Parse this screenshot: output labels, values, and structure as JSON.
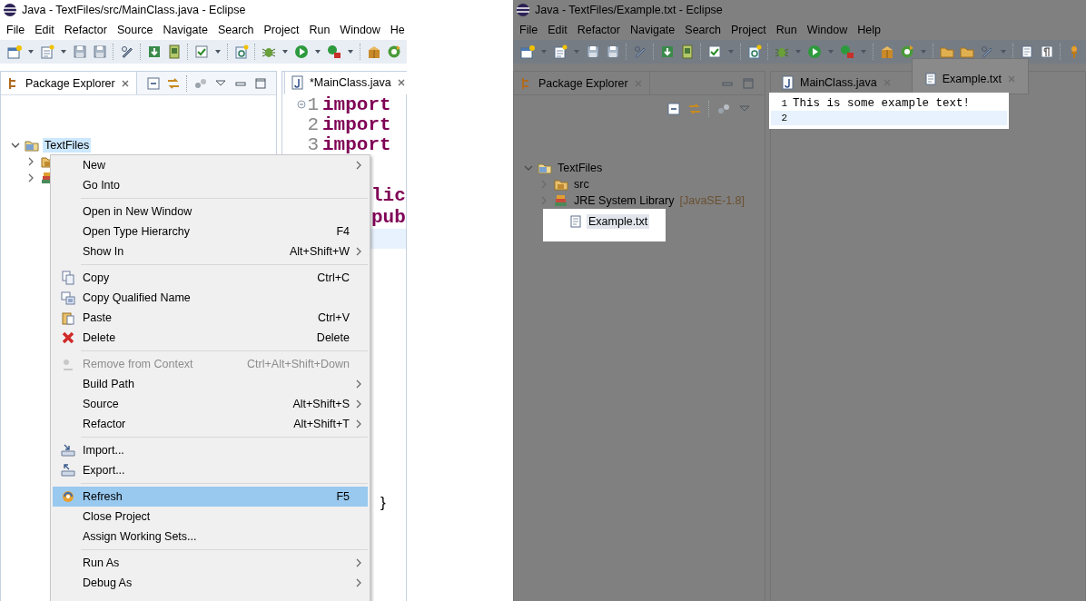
{
  "windows": [
    {
      "title": "Java - TextFiles/src/MainClass.java - Eclipse",
      "dimmed": false,
      "menu": [
        "File",
        "Edit",
        "Refactor",
        "Source",
        "Navigate",
        "Search",
        "Project",
        "Run",
        "Window",
        "He"
      ],
      "explorer": {
        "tab": "Package Explorer",
        "tree": [
          {
            "label": "TextFiles",
            "kind": "project",
            "expanded": true,
            "selected": true,
            "highlighted": false,
            "children": [
              {
                "kind": "package-folder",
                "expanded": false
              },
              {
                "kind": "library",
                "expanded": false
              }
            ]
          }
        ]
      },
      "editor": {
        "highlighted": false,
        "tabs": [
          {
            "label": "*MainClass.java",
            "kind": "java",
            "selected": true,
            "highlighted": false
          }
        ],
        "lines": [
          {
            "number": "1",
            "text": "import",
            "foldable": true
          },
          {
            "number": "2",
            "text": "import"
          },
          {
            "number": "3",
            "text": "import"
          },
          {
            "text": "lic"
          },
          {
            "text": "pub"
          },
          {
            "current": true
          }
        ],
        "closing": "}"
      },
      "context_menu": {
        "items": [
          {
            "kind": "plain",
            "label": "New",
            "submenu": true,
            "disabled": false,
            "selected": false
          },
          {
            "kind": "plain",
            "label": "Go Into",
            "submenu": false,
            "disabled": false,
            "selected": false
          },
          {
            "kind": "separator"
          },
          {
            "kind": "plain",
            "label": "Open in New Window",
            "submenu": false,
            "disabled": false,
            "selected": false
          },
          {
            "kind": "plain",
            "label": "Open Type Hierarchy",
            "shortcut": "F4",
            "submenu": false,
            "disabled": false,
            "selected": false
          },
          {
            "kind": "plain",
            "label": "Show In",
            "shortcut": "Alt+Shift+W",
            "submenu": true,
            "disabled": false,
            "selected": false
          },
          {
            "kind": "separator"
          },
          {
            "kind": "copy",
            "label": "Copy",
            "shortcut": "Ctrl+C",
            "submenu": false,
            "disabled": false,
            "selected": false
          },
          {
            "kind": "copy-name",
            "label": "Copy Qualified Name",
            "submenu": false,
            "disabled": false,
            "selected": false
          },
          {
            "kind": "paste",
            "label": "Paste",
            "shortcut": "Ctrl+V",
            "submenu": false,
            "disabled": false,
            "selected": false
          },
          {
            "kind": "delete",
            "label": "Delete",
            "shortcut": "Delete",
            "submenu": false,
            "disabled": false,
            "selected": false
          },
          {
            "kind": "separator"
          },
          {
            "kind": "remove",
            "label": "Remove from Context",
            "shortcut": "Ctrl+Alt+Shift+Down",
            "submenu": false,
            "disabled": true,
            "selected": false
          },
          {
            "kind": "plain",
            "label": "Build Path",
            "submenu": true,
            "disabled": false,
            "selected": false
          },
          {
            "kind": "plain",
            "label": "Source",
            "shortcut": "Alt+Shift+S",
            "submenu": true,
            "disabled": false,
            "selected": false
          },
          {
            "kind": "plain",
            "label": "Refactor",
            "shortcut": "Alt+Shift+T",
            "submenu": true,
            "disabled": false,
            "selected": false
          },
          {
            "kind": "separator"
          },
          {
            "kind": "import",
            "label": "Import...",
            "submenu": false,
            "disabled": false,
            "selected": false
          },
          {
            "kind": "export",
            "label": "Export...",
            "submenu": false,
            "disabled": false,
            "selected": false
          },
          {
            "kind": "separator"
          },
          {
            "kind": "refresh",
            "label": "Refresh",
            "shortcut": "F5",
            "submenu": false,
            "disabled": false,
            "selected": true
          },
          {
            "kind": "plain",
            "label": "Close Project",
            "submenu": false,
            "disabled": false,
            "selected": false
          },
          {
            "kind": "plain",
            "label": "Assign Working Sets...",
            "submenu": false,
            "disabled": false,
            "selected": false
          },
          {
            "kind": "separator"
          },
          {
            "kind": "plain",
            "label": "Run As",
            "submenu": true,
            "disabled": false,
            "selected": false
          },
          {
            "kind": "plain",
            "label": "Debug As",
            "submenu": true,
            "disabled": false,
            "selected": false
          }
        ]
      }
    },
    {
      "title": "Java - TextFiles/Example.txt - Eclipse",
      "dimmed": true,
      "menu": [
        "File",
        "Edit",
        "Refactor",
        "Navigate",
        "Search",
        "Project",
        "Run",
        "Window",
        "Help"
      ],
      "explorer": {
        "tab": "Package Explorer",
        "tree": [
          {
            "label": "TextFiles",
            "kind": "project",
            "expanded": true,
            "selected": false,
            "highlighted": false,
            "children": [
              {
                "label": "src",
                "kind": "package-folder",
                "expanded": false,
                "selected": false,
                "highlighted": false
              },
              {
                "label": "JRE System Library",
                "decoration": "[JavaSE-1.8]",
                "kind": "library",
                "expanded": false,
                "selected": false,
                "highlighted": false
              },
              {
                "label": "Example.txt",
                "kind": "text-file",
                "selected": true,
                "highlighted": true
              }
            ]
          }
        ]
      },
      "editor": {
        "highlighted": true,
        "tabs": [
          {
            "label": "MainClass.java",
            "kind": "java",
            "selected": false,
            "highlighted": false
          },
          {
            "label": "Example.txt",
            "kind": "text",
            "selected": true,
            "highlighted": true
          }
        ],
        "lines": [
          {
            "number": "1",
            "text": "This is some example text!"
          },
          {
            "number": "2",
            "current": true
          }
        ]
      }
    }
  ]
}
